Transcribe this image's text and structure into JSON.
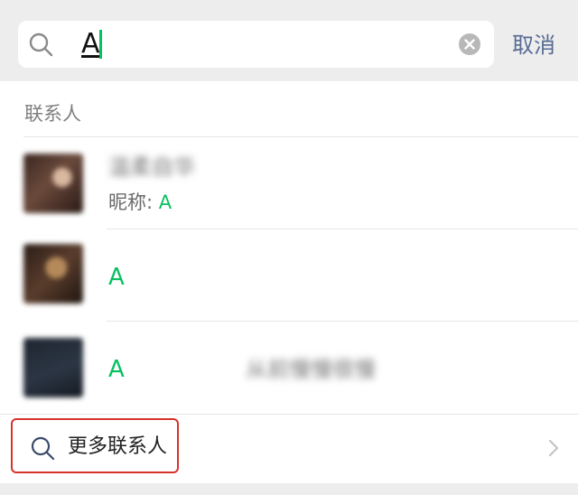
{
  "search": {
    "query": "A",
    "cancel_label": "取消"
  },
  "results": {
    "section_title": "联系人",
    "contacts": [
      {
        "name_blurred": "温柔自华",
        "nickname_prefix": "昵称: ",
        "nickname_match": "A"
      },
      {
        "match": "A"
      },
      {
        "match": "A",
        "extra_blurred": "从前慢慢很慢"
      }
    ],
    "more_label": "更多联系人"
  },
  "colors": {
    "highlight": "#07c160",
    "cancel": "#576b95",
    "annotation_box": "#d7322c"
  },
  "icons": [
    "search-icon",
    "clear-icon",
    "chevron-right-icon"
  ]
}
